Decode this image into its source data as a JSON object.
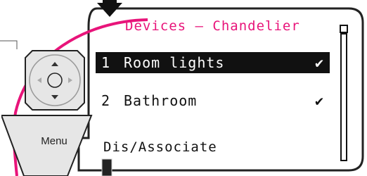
{
  "screen": {
    "title": "Devices — Chandelier",
    "items": [
      {
        "number": "1",
        "label": "Room lights",
        "checked": true,
        "selected": true
      },
      {
        "number": "2",
        "label": "Bathroom",
        "checked": true,
        "selected": false
      }
    ],
    "check_mark": "✔",
    "softkey_label": "Dis/Associate"
  },
  "keypad": {
    "menu_label": "Menu"
  },
  "colors": {
    "accent": "#e8147a",
    "frame": "#222222",
    "selection_bg": "#111111",
    "button_fill": "#e6e6e6"
  }
}
